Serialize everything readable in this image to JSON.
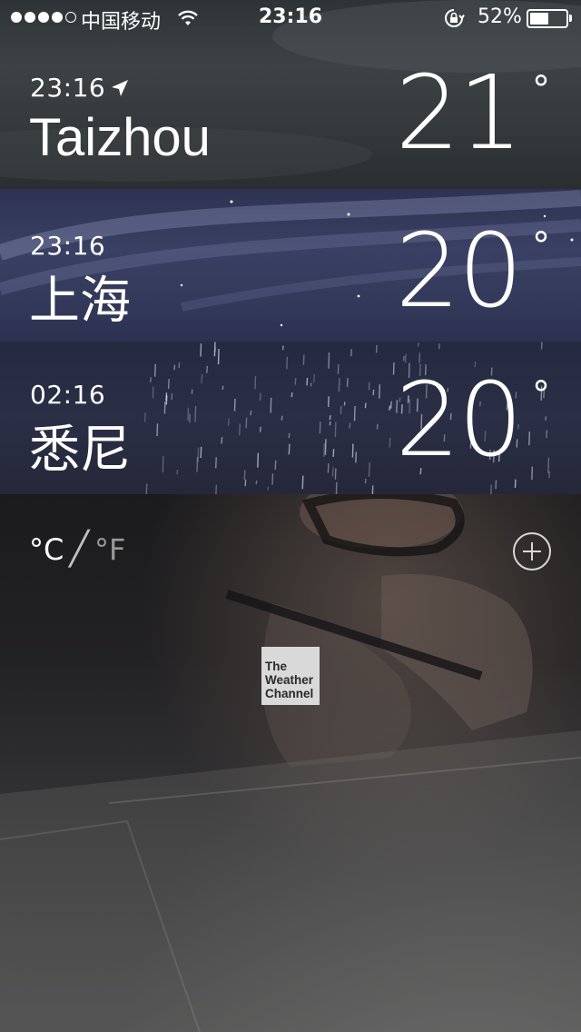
{
  "status_bar": {
    "carrier": "中国移动",
    "time": "23:16",
    "battery_percent": "52%",
    "battery_level": 0.52
  },
  "cities": [
    {
      "time": "23:16",
      "name": "Taizhou",
      "temperature": "21",
      "current_location": true
    },
    {
      "time": "23:16",
      "name": "上海",
      "temperature": "20",
      "current_location": false
    },
    {
      "time": "02:16",
      "name": "悉尼",
      "temperature": "20",
      "current_location": false
    }
  ],
  "degree_symbol": "°",
  "units": {
    "celsius": "°C",
    "separator": "╱",
    "fahrenheit": "°F",
    "selected": "celsius"
  },
  "logo": {
    "line1": "The",
    "line2": "Weather",
    "line3": "Channel"
  },
  "icons": {
    "signal": "signal-dots-icon",
    "wifi": "wifi-icon",
    "rotation_lock": "rotation-lock-icon",
    "battery": "battery-icon",
    "location": "location-arrow-icon",
    "add": "plus-circle-icon"
  }
}
